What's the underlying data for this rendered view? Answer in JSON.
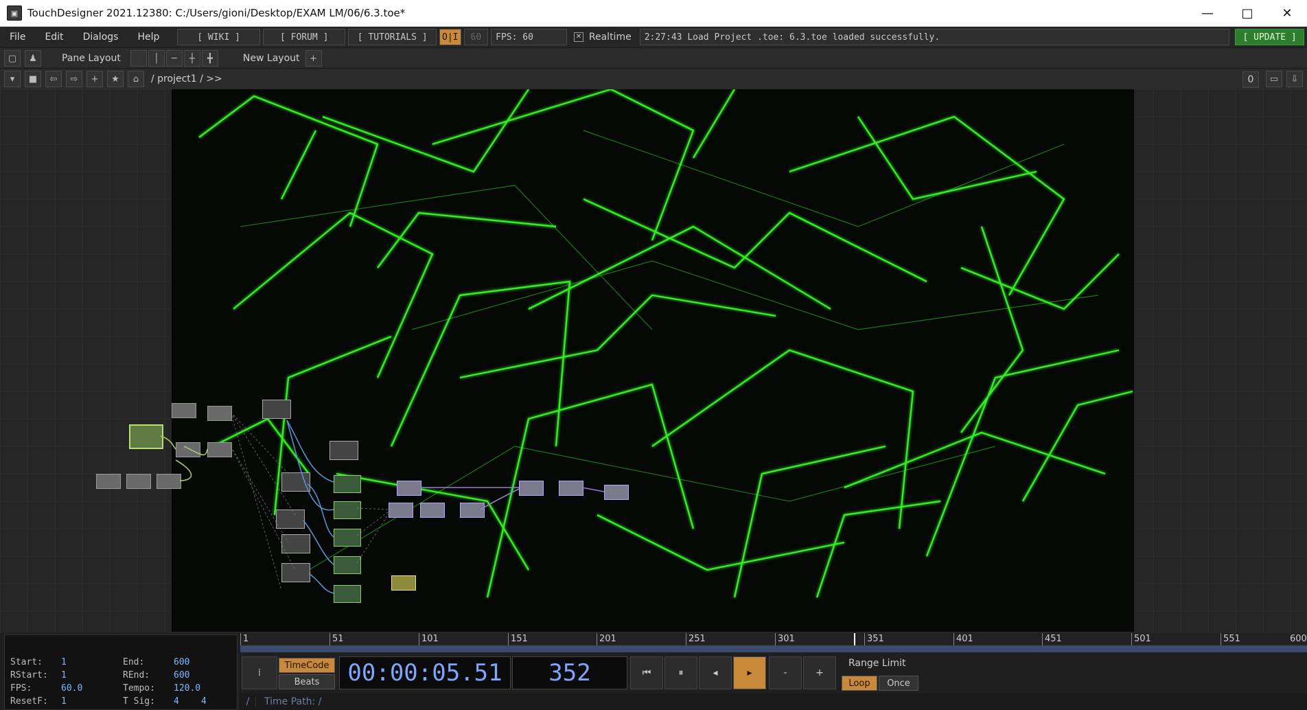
{
  "window": {
    "title": "TouchDesigner 2021.12380: C:/Users/gioni/Desktop/EXAM LM/06/6.3.toe*",
    "icon": "touchdesigner-logo-icon",
    "controls": [
      "minimize-icon",
      "maximize-icon",
      "close-icon"
    ]
  },
  "menubar": {
    "items": [
      "File",
      "Edit",
      "Dialogs",
      "Help"
    ],
    "wiki": "[ WIKI ]",
    "forum": "[ FORUM ]",
    "tutorials": "[ TUTORIALS ]",
    "oi": "O|I",
    "fps_value_box": "60",
    "fps": "FPS:  60",
    "realtime": "Realtime",
    "status": "2:27:43 Load Project .toe: 6.3.toe loaded successfully.",
    "update": "[ UPDATE ]"
  },
  "toolbar": {
    "pane_layout": "Pane Layout",
    "new_layout": "New Layout",
    "add": "+"
  },
  "pathbar": {
    "path": "/ project1 / >>",
    "right_num": "0"
  },
  "timeline": {
    "labels": {
      "start": "Start:",
      "end": "End:",
      "rstart": "RStart:",
      "rend": "REnd:",
      "fps": "FPS:",
      "tempo": "Tempo:",
      "resetf": "ResetF:",
      "tsig": "T Sig:"
    },
    "values": {
      "start": "1",
      "end": "600",
      "rstart": "1",
      "rend": "600",
      "fps": "60.0",
      "tempo": "120.0",
      "resetf": "1",
      "tsig_a": "4",
      "tsig_b": "4"
    },
    "ruler_ticks": [
      "1",
      "51",
      "101",
      "151",
      "201",
      "251",
      "301",
      "351",
      "401",
      "451",
      "501",
      "551",
      "600"
    ],
    "current_frame_progress": 0.5866,
    "timecode_btn": "TimeCode",
    "beats_btn": "Beats",
    "timecode": "00:00:05.51",
    "frame": "352",
    "range_limit": "Range Limit",
    "loop": "Loop",
    "once": "Once",
    "minus": "-",
    "plus": "+",
    "time_path": "Time Path: /",
    "slash": "/"
  },
  "colors": {
    "accent_orange": "#c88a3a",
    "viewer_green": "#3dff2a",
    "update_green": "#2e7d2e",
    "value_blue": "#7fb8ff"
  }
}
